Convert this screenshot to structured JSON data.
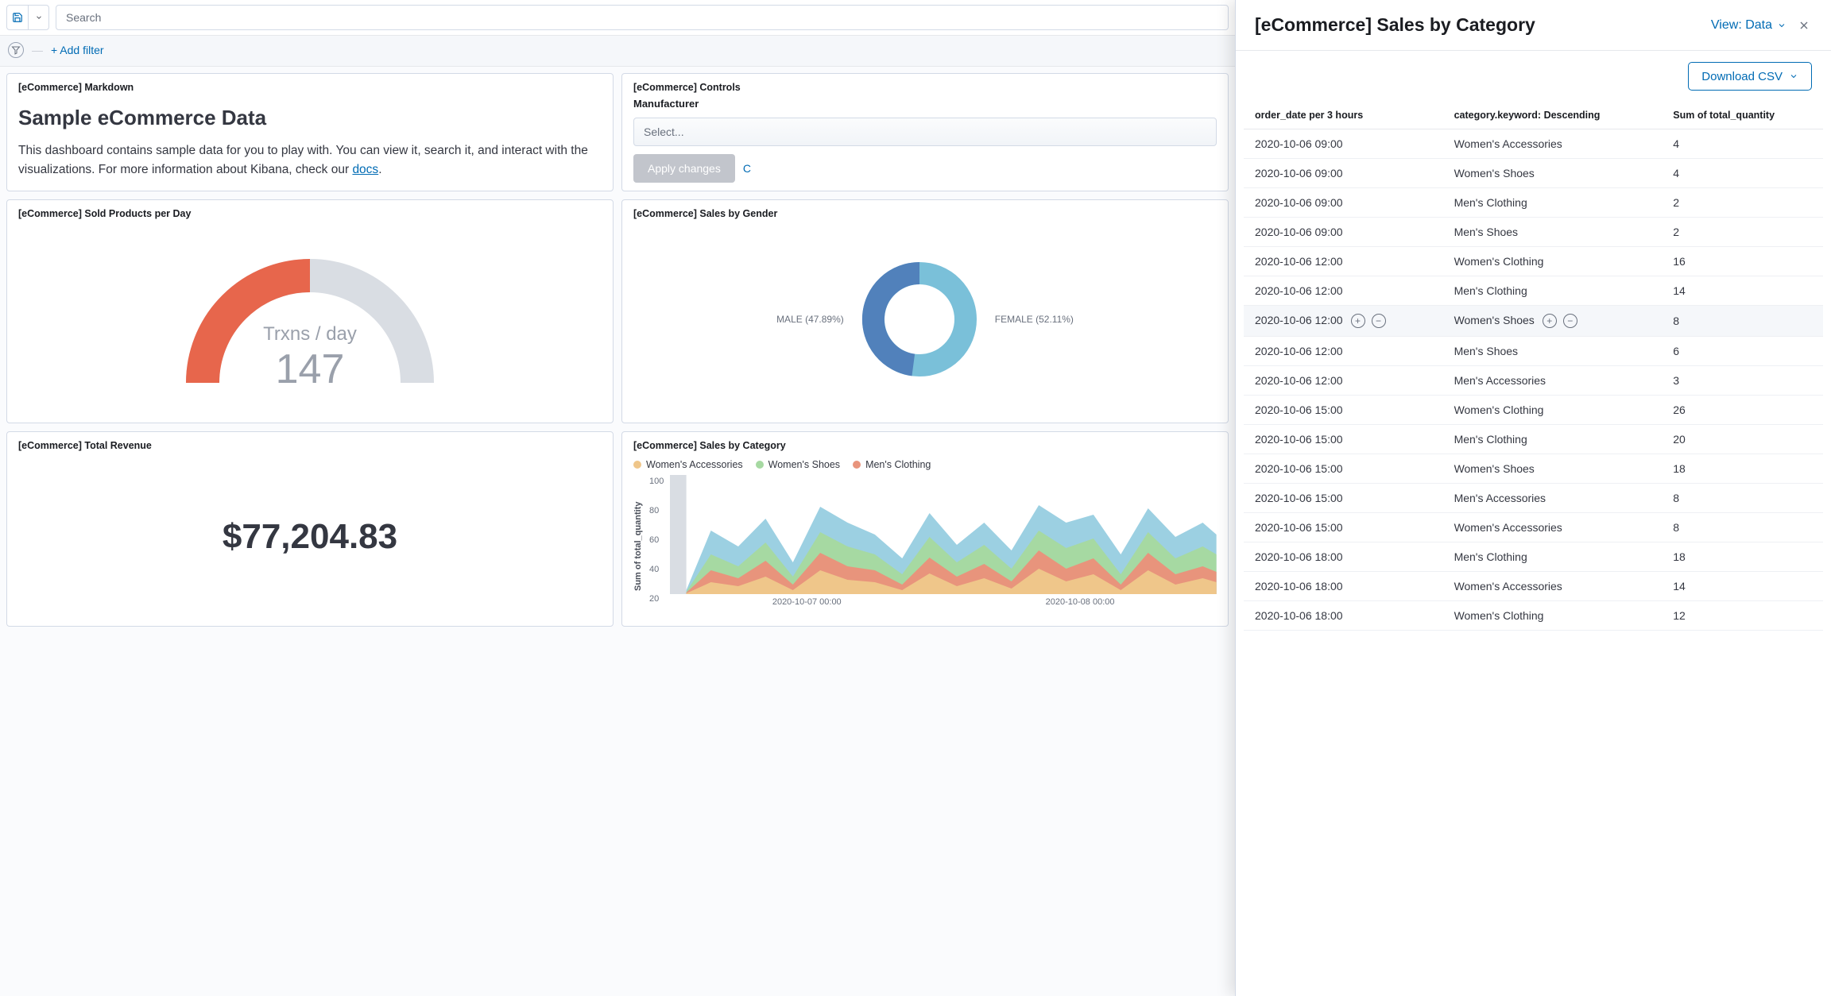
{
  "toolbar": {
    "search_placeholder": "Search",
    "add_filter_label": "+ Add filter"
  },
  "panels": {
    "markdown": {
      "title": "[eCommerce] Markdown",
      "heading": "Sample eCommerce Data",
      "body_before_link": "This dashboard contains sample data for you to play with. You can view it, search it, and interact with the visualizations. For more information about Kibana, check our ",
      "link_text": "docs",
      "body_after_link": "."
    },
    "controls": {
      "title": "[eCommerce] Controls",
      "field_label": "Manufacturer",
      "select_placeholder": "Select...",
      "apply_label": "Apply changes",
      "cancel_label": "C"
    },
    "gauge": {
      "title": "[eCommerce] Sold Products per Day",
      "center_label": "Trxns / day",
      "center_value": "147"
    },
    "gender": {
      "title": "[eCommerce] Sales by Gender",
      "male_label": "MALE (47.89%)",
      "female_label": "FEMALE (52.11%)"
    },
    "revenue": {
      "title": "[eCommerce] Total Revenue",
      "amount": "$77,204.83"
    },
    "category": {
      "title": "[eCommerce] Sales by Category",
      "legend": [
        "Women's Accessories",
        "Women's Shoes",
        "Men's Clothing"
      ],
      "ylabel": "Sum of total_quantity",
      "yticks": [
        "100",
        "80",
        "60",
        "40",
        "20"
      ],
      "xticks": [
        "2020-10-07 00:00",
        "2020-10-08 00:00"
      ]
    }
  },
  "flyout": {
    "title": "[eCommerce] Sales by Category",
    "view_label": "View: Data",
    "download_label": "Download CSV",
    "columns": [
      "order_date per 3 hours",
      "category.keyword: Descending",
      "Sum of total_quantity"
    ],
    "hovered_row_index": 6,
    "rows": [
      {
        "date": "2020-10-06 09:00",
        "cat": "Women's Accessories",
        "qty": "4"
      },
      {
        "date": "2020-10-06 09:00",
        "cat": "Women's Shoes",
        "qty": "4"
      },
      {
        "date": "2020-10-06 09:00",
        "cat": "Men's Clothing",
        "qty": "2"
      },
      {
        "date": "2020-10-06 09:00",
        "cat": "Men's Shoes",
        "qty": "2"
      },
      {
        "date": "2020-10-06 12:00",
        "cat": "Women's Clothing",
        "qty": "16"
      },
      {
        "date": "2020-10-06 12:00",
        "cat": "Men's Clothing",
        "qty": "14"
      },
      {
        "date": "2020-10-06 12:00",
        "cat": "Women's Shoes",
        "qty": "8"
      },
      {
        "date": "2020-10-06 12:00",
        "cat": "Men's Shoes",
        "qty": "6"
      },
      {
        "date": "2020-10-06 12:00",
        "cat": "Men's Accessories",
        "qty": "3"
      },
      {
        "date": "2020-10-06 15:00",
        "cat": "Women's Clothing",
        "qty": "26"
      },
      {
        "date": "2020-10-06 15:00",
        "cat": "Men's Clothing",
        "qty": "20"
      },
      {
        "date": "2020-10-06 15:00",
        "cat": "Women's Shoes",
        "qty": "18"
      },
      {
        "date": "2020-10-06 15:00",
        "cat": "Men's Accessories",
        "qty": "8"
      },
      {
        "date": "2020-10-06 15:00",
        "cat": "Women's Accessories",
        "qty": "8"
      },
      {
        "date": "2020-10-06 18:00",
        "cat": "Men's Clothing",
        "qty": "18"
      },
      {
        "date": "2020-10-06 18:00",
        "cat": "Women's Accessories",
        "qty": "14"
      },
      {
        "date": "2020-10-06 18:00",
        "cat": "Women's Clothing",
        "qty": "12"
      }
    ]
  },
  "colors": {
    "gauge_fill": "#e7664c",
    "gauge_track": "#d9dde3",
    "donut_male": "#5181bb",
    "donut_female": "#7ac0d9",
    "legend1": "#efc68a",
    "legend2": "#a6d9a2",
    "legend3": "#e8947c"
  },
  "chart_data": {
    "gauge": {
      "type": "gauge",
      "value": 147,
      "fill_fraction": 0.5,
      "label": "Trxns / day"
    },
    "gender_pie": {
      "type": "pie",
      "series": [
        {
          "name": "MALE",
          "value": 47.89
        },
        {
          "name": "FEMALE",
          "value": 52.11
        }
      ]
    },
    "category_area": {
      "type": "area",
      "ylabel": "Sum of total_quantity",
      "ylim": [
        0,
        100
      ],
      "xticks": [
        "2020-10-07 00:00",
        "2020-10-08 00:00"
      ],
      "series": [
        {
          "name": "Women's Accessories",
          "values_approx": [
            5,
            20,
            18,
            25,
            14,
            30,
            26,
            24,
            18,
            30,
            22,
            28,
            20,
            32,
            26,
            30,
            18,
            30,
            22,
            26
          ]
        },
        {
          "name": "Women's Shoes",
          "values_approx": [
            4,
            18,
            14,
            22,
            12,
            26,
            22,
            20,
            14,
            26,
            18,
            24,
            16,
            28,
            22,
            26,
            14,
            26,
            18,
            22
          ]
        },
        {
          "name": "Men's Clothing",
          "values_approx": [
            8,
            32,
            26,
            40,
            22,
            48,
            38,
            34,
            26,
            46,
            32,
            42,
            28,
            50,
            40,
            44,
            26,
            48,
            34,
            40
          ]
        }
      ]
    }
  }
}
